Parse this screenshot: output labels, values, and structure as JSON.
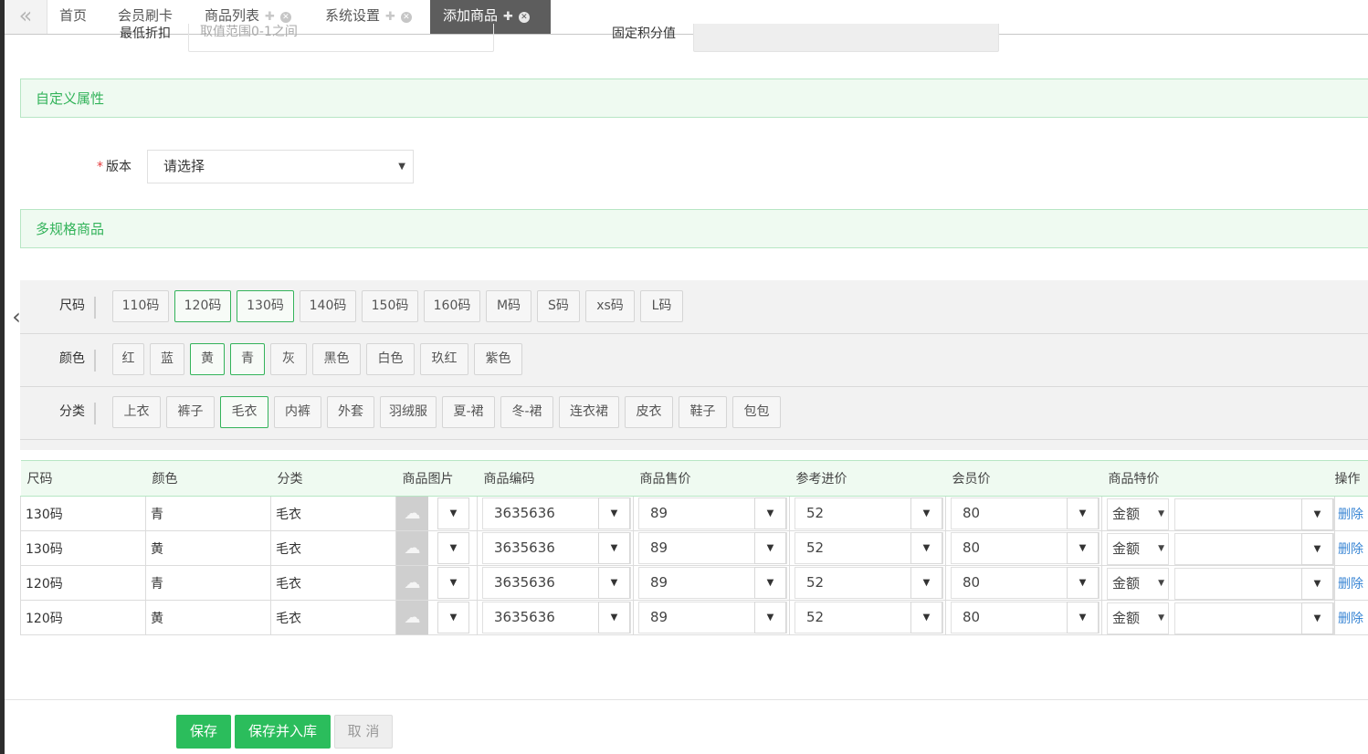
{
  "tabs": {
    "back_icon": "double-chevron-left-icon",
    "items": [
      {
        "label": "首页"
      },
      {
        "label": "会员刷卡"
      },
      {
        "label": "商品列表"
      },
      {
        "label": "系统设置"
      },
      {
        "label": "添加商品"
      }
    ]
  },
  "form_top": {
    "discount_label": "最低折扣",
    "discount_placeholder": "取值范围0-1之间",
    "points_label": "固定积分值"
  },
  "custom_attrs": {
    "title": "自定义属性",
    "version_label": "版本",
    "version_value": "请选择"
  },
  "multi_spec": {
    "title": "多规格商品"
  },
  "spec": {
    "size": {
      "label": "尺码",
      "options": [
        "110码",
        "120码",
        "130码",
        "140码",
        "150码",
        "160码",
        "M码",
        "S码",
        "xs码",
        "L码"
      ],
      "selected": [
        "120码",
        "130码"
      ]
    },
    "color": {
      "label": "颜色",
      "options": [
        "红",
        "蓝",
        "黄",
        "青",
        "灰",
        "黑色",
        "白色",
        "玖红",
        "紫色"
      ],
      "selected": [
        "黄",
        "青"
      ]
    },
    "category": {
      "label": "分类",
      "options": [
        "上衣",
        "裤子",
        "毛衣",
        "内裤",
        "外套",
        "羽绒服",
        "夏-裙",
        "冬-裙",
        "连衣裙",
        "皮衣",
        "鞋子",
        "包包"
      ],
      "selected": [
        "毛衣"
      ]
    }
  },
  "table": {
    "headers": [
      "尺码",
      "颜色",
      "分类",
      "商品图片",
      "商品编码",
      "商品售价",
      "参考进价",
      "会员价",
      "商品特价",
      "操作"
    ],
    "rows": [
      {
        "size": "130码",
        "color": "青",
        "category": "毛衣",
        "code": "3635636",
        "price": "89",
        "cost": "52",
        "member": "80",
        "special_type": "金额",
        "special_value": "",
        "action": "删除"
      },
      {
        "size": "130码",
        "color": "黄",
        "category": "毛衣",
        "code": "3635636",
        "price": "89",
        "cost": "52",
        "member": "80",
        "special_type": "金额",
        "special_value": "",
        "action": "删除"
      },
      {
        "size": "120码",
        "color": "青",
        "category": "毛衣",
        "code": "3635636",
        "price": "89",
        "cost": "52",
        "member": "80",
        "special_type": "金额",
        "special_value": "",
        "action": "删除"
      },
      {
        "size": "120码",
        "color": "黄",
        "category": "毛衣",
        "code": "3635636",
        "price": "89",
        "cost": "52",
        "member": "80",
        "special_type": "金额",
        "special_value": "",
        "action": "删除"
      }
    ]
  },
  "buttons": {
    "save": "保存",
    "save_stock": "保存并入库",
    "cancel": "取 消"
  },
  "colors": {
    "accent": "#2bbd5c",
    "section_bg": "#effaf1",
    "section_text": "#33b35a",
    "link": "#3a86d4",
    "active_tab": "#5d5d5d"
  }
}
